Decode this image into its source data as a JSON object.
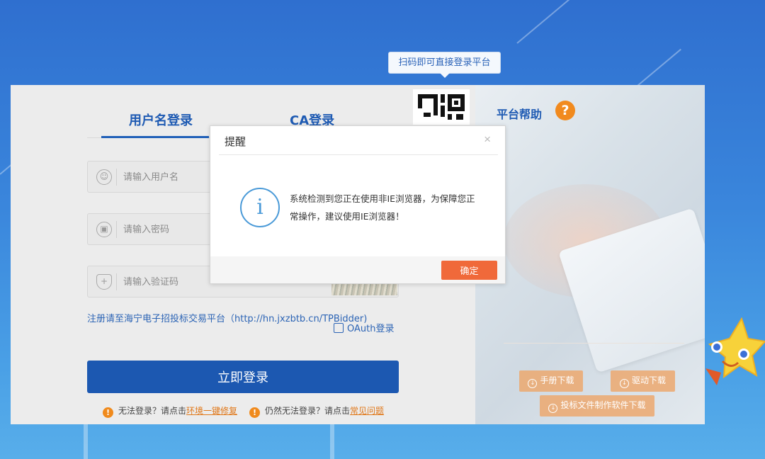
{
  "qr_tooltip": "扫码即可直接登录平台",
  "tabs": [
    {
      "label": "用户名登录"
    },
    {
      "label": "CA登录"
    }
  ],
  "form": {
    "username_placeholder": "请输入用户名",
    "password_placeholder": "请输入密码",
    "captcha_placeholder": "请输入验证码"
  },
  "register_text": "注册请至海宁电子招投标交易平台（http://hn.jxzbtb.cn/TPBidder)",
  "oauth_label": "OAuth登录",
  "login_button": "立即登录",
  "hints": [
    {
      "prefix": "无法登录？请点击",
      "link": "环境一键修复"
    },
    {
      "prefix": "仍然无法登录？请点击",
      "link": "常见问题"
    }
  ],
  "help": {
    "label": "平台帮助",
    "icon": "question-icon"
  },
  "downloads": [
    {
      "label": "手册下载"
    },
    {
      "label": "驱动下载"
    },
    {
      "label": "投标文件制作软件下载"
    }
  ],
  "modal": {
    "title": "提醒",
    "close": "×",
    "message": "系统检测到您正在使用非IE浏览器，为保障您正常操作，建议使用IE浏览器！",
    "ok_button": "确定"
  },
  "colors": {
    "brand_blue": "#1c58b1",
    "accent_orange": "#f0693a",
    "warning_orange": "#f08a1c"
  }
}
